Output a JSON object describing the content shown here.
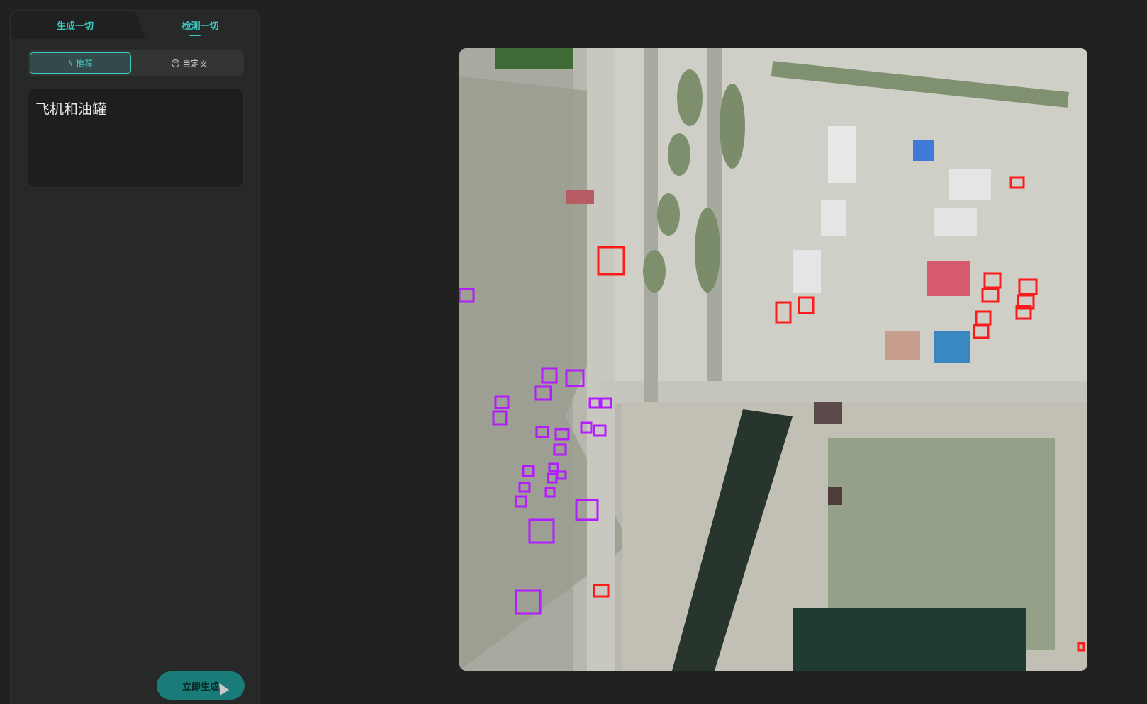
{
  "tabs": {
    "generate_label": "生成一切",
    "detect_label": "检测一切"
  },
  "mode_switch": {
    "recommended_label": "推荐",
    "custom_label": "自定义"
  },
  "prompt": {
    "value": "飞机和油罐"
  },
  "generate_button_label": "立即生成",
  "detections": {
    "airplane_color": "#ff1a1a",
    "tank_color": "#b21cff"
  }
}
